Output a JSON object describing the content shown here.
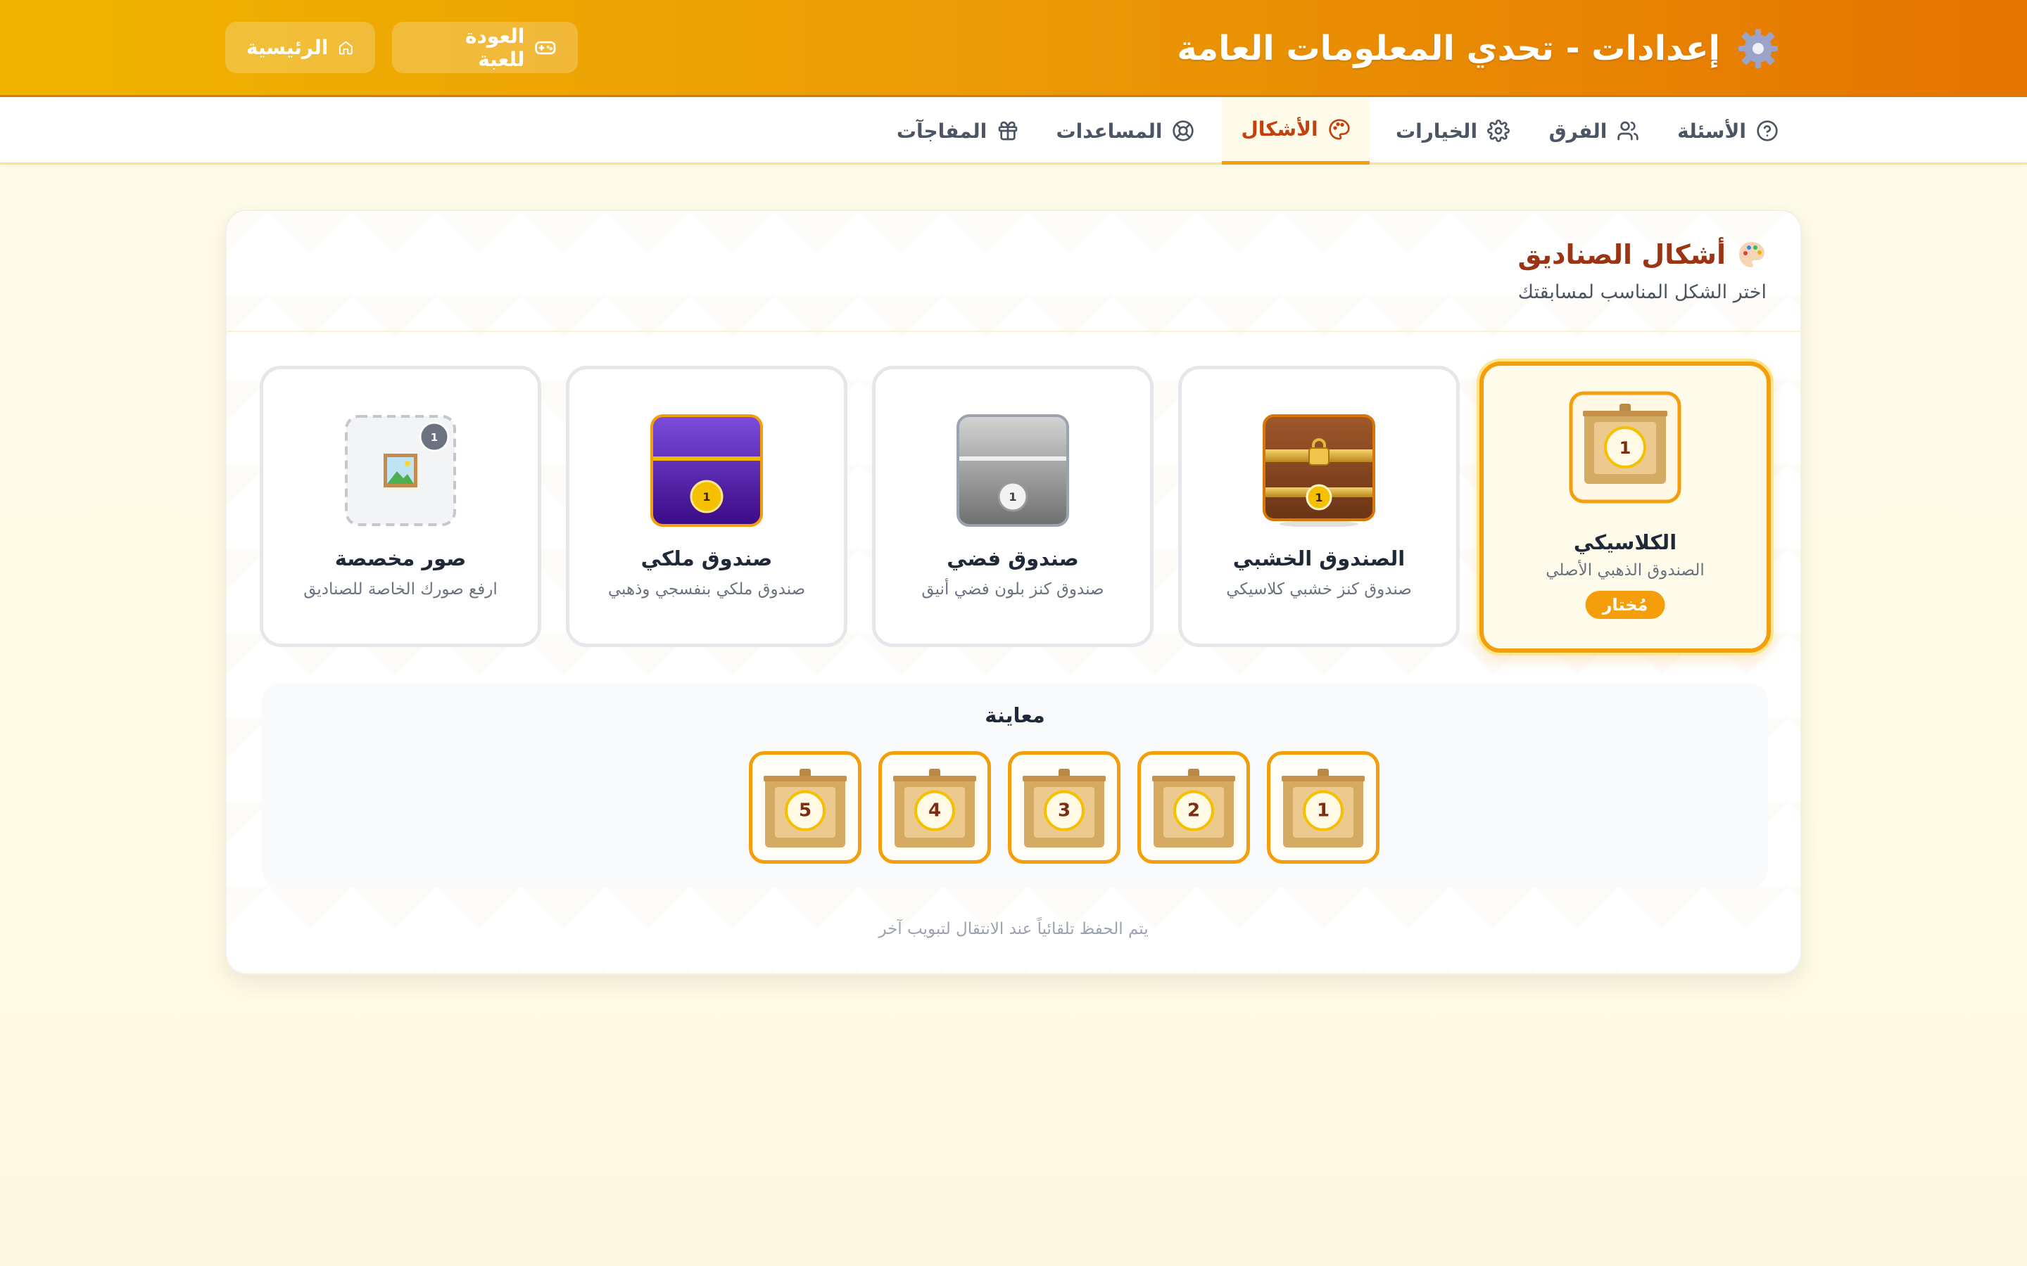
{
  "header": {
    "title": "إعدادات - تحدي المعلومات العامة",
    "back_to_game": "العودة للعبة",
    "home": "الرئيسية"
  },
  "tabs": [
    {
      "label": "الأسئلة",
      "icon": "question-circle-icon"
    },
    {
      "label": "الفرق",
      "icon": "users-icon"
    },
    {
      "label": "الخيارات",
      "icon": "gear-icon"
    },
    {
      "label": "الأشكال",
      "icon": "palette-icon",
      "active": true
    },
    {
      "label": "المساعدات",
      "icon": "lifebuoy-icon"
    },
    {
      "label": "المفاجآت",
      "icon": "gift-icon"
    }
  ],
  "section": {
    "title": "أشكال الصناديق",
    "subtitle": "اختر الشكل المناسب لمسابقتك"
  },
  "shapes": [
    {
      "name": "الكلاسيكي",
      "desc": "الصندوق الذهبي الأصلي",
      "selected": true,
      "badge": "مُختار",
      "icon": "classic-box-icon",
      "number": "1"
    },
    {
      "name": "الصندوق الخشبي",
      "desc": "صندوق كنز خشبي كلاسيكي",
      "icon": "wooden-chest-icon",
      "number": "1"
    },
    {
      "name": "صندوق فضي",
      "desc": "صندوق كنز بلون فضي أنيق",
      "icon": "silver-box-icon",
      "number": "1"
    },
    {
      "name": "صندوق ملكي",
      "desc": "صندوق ملكي بنفسجي وذهبي",
      "icon": "royal-box-icon",
      "number": "1"
    },
    {
      "name": "صور مخصصة",
      "desc": "ارفع صورك الخاصة للصناديق",
      "icon": "image-icon",
      "number": "1"
    }
  ],
  "preview": {
    "title": "معاينة",
    "numbers": [
      "1",
      "2",
      "3",
      "4",
      "5"
    ]
  },
  "autosave": "يتم الحفظ تلقائياً عند الانتقال لتبويب آخر",
  "colors": {
    "accent": "#f59e0b",
    "header_start": "#f0b400",
    "header_end": "#e57400",
    "title_brown": "#9a3412"
  }
}
